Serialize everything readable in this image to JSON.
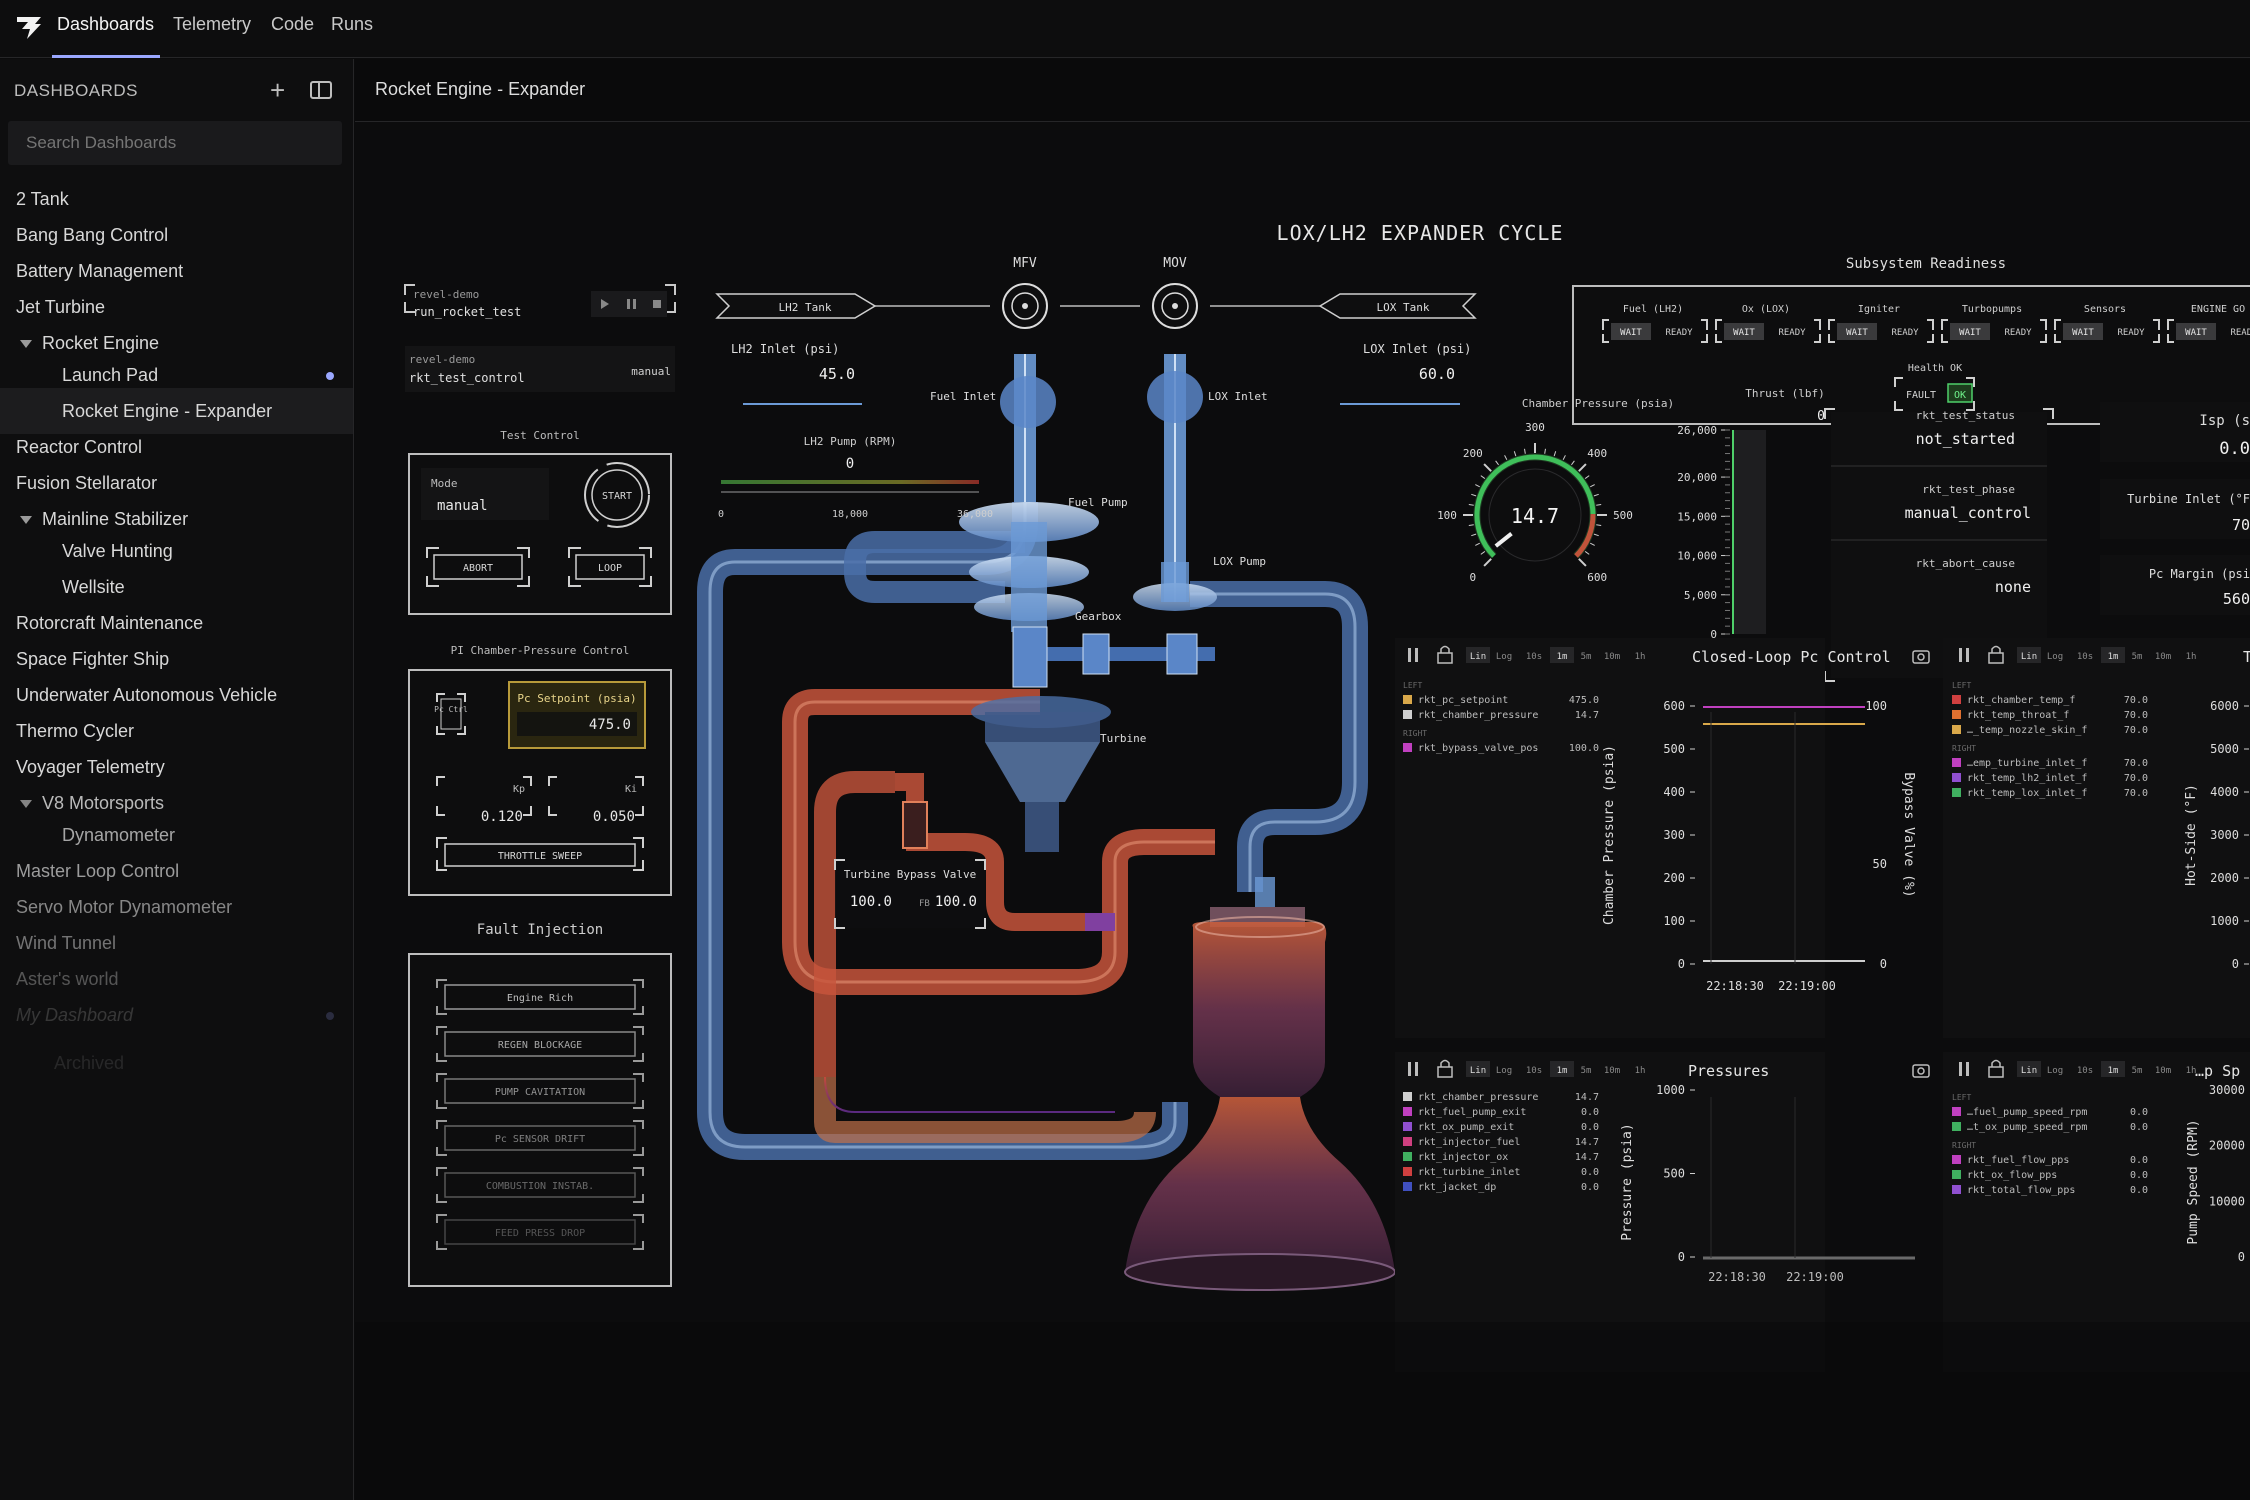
{
  "nav": {
    "tabs": [
      "Dashboards",
      "Telemetry",
      "Code",
      "Runs"
    ]
  },
  "sidebar": {
    "title": "DASHBOARDS",
    "search_placeholder": "Search Dashboards",
    "items": [
      {
        "label": "2 Tank"
      },
      {
        "label": "Bang Bang Control"
      },
      {
        "label": "Battery Management"
      },
      {
        "label": "Jet Turbine"
      },
      {
        "label": "Rocket Engine"
      },
      {
        "label": "Launch Pad"
      },
      {
        "label": "Rocket Engine - Expander"
      },
      {
        "label": "Reactor Control"
      },
      {
        "label": "Fusion Stellarator"
      },
      {
        "label": "Mainline Stabilizer"
      },
      {
        "label": "Valve Hunting"
      },
      {
        "label": "Wellsite"
      },
      {
        "label": "Rotorcraft Maintenance"
      },
      {
        "label": "Space Fighter Ship"
      },
      {
        "label": "Underwater Autonomous Vehicle"
      },
      {
        "label": "Thermo Cycler"
      },
      {
        "label": "Voyager Telemetry"
      },
      {
        "label": "V8 Motorsports"
      },
      {
        "label": "Dynamometer"
      },
      {
        "label": "Master Loop Control"
      },
      {
        "label": "Servo Motor Dynamometer"
      },
      {
        "label": "Wind Tunnel"
      },
      {
        "label": "Aster's world"
      },
      {
        "label": "My Dashboard"
      },
      {
        "label": "Archived"
      }
    ]
  },
  "breadcrumb": "Rocket Engine - Expander",
  "diagram": {
    "title": "LOX/LH2 EXPANDER CYCLE",
    "mfv": "MFV",
    "mov": "MOV",
    "lh2_tank": "LH2 Tank",
    "lox_tank": "LOX Tank",
    "lh2_inlet_label": "LH2 Inlet (psi)",
    "lh2_inlet_value": "45.0",
    "lox_inlet_label": "LOX Inlet (psi)",
    "lox_inlet_value": "60.0",
    "lh2_pump_label": "LH2 Pump (RPM)",
    "lh2_pump_value": "0",
    "lh2_pump_ticks": [
      "0",
      "18,000",
      "36,000"
    ],
    "fuel_inlet": "Fuel Inlet",
    "lox_inlet": "LOX Inlet",
    "fuel_pump": "Fuel Pump",
    "lox_pump": "LOX Pump",
    "gearbox": "Gearbox",
    "turbine": "Turbine",
    "tbv_label": "Turbine Bypass Valve",
    "tbv_cmd": "100.0",
    "tbv_fb_label": "FB",
    "tbv_fb": "100.0"
  },
  "run": {
    "proj1": "revel-demo",
    "name1": "run_rocket_test",
    "proj2": "revel-demo",
    "name2": "rkt_test_control",
    "mode2": "manual"
  },
  "test_control": {
    "title": "Test Control",
    "mode_label": "Mode",
    "mode_value": "manual",
    "start": "START",
    "abort": "ABORT",
    "loop": "LOOP"
  },
  "pi_control": {
    "title": "PI Chamber-Pressure Control",
    "pc_ctrl": "Pc Ctrl",
    "setpoint_label": "Pc Setpoint (psia)",
    "setpoint_value": "475.0",
    "kp_label": "Kp",
    "kp_value": "0.120",
    "ki_label": "Ki",
    "ki_value": "0.050",
    "throttle": "THROTTLE SWEEP"
  },
  "faults": {
    "title": "Fault Injection",
    "items": [
      "Engine Rich",
      "REGEN BLOCKAGE",
      "PUMP CAVITATION",
      "Pc SENSOR DRIFT",
      "COMBUSTION INSTAB.",
      "FEED PRESS DROP"
    ]
  },
  "readiness": {
    "title": "Subsystem Readiness",
    "groups": [
      {
        "name": "Fuel (LH2)",
        "a": "WAIT",
        "b": "READY"
      },
      {
        "name": "Ox (LOX)",
        "a": "WAIT",
        "b": "READY"
      },
      {
        "name": "Igniter",
        "a": "WAIT",
        "b": "READY"
      },
      {
        "name": "Turbopumps",
        "a": "WAIT",
        "b": "READY"
      },
      {
        "name": "Sensors",
        "a": "WAIT",
        "b": "READY"
      },
      {
        "name": "ENGINE GO",
        "a": "WAIT",
        "b": "READY"
      }
    ],
    "health_label": "Health OK",
    "fault": "FAULT",
    "ok": "OK"
  },
  "gauge": {
    "title": "Chamber Pressure (psia)",
    "value": "14.7",
    "reading": 14.7,
    "min": 0,
    "max": 600,
    "ticks": [
      "0",
      "100",
      "200",
      "300",
      "400",
      "500",
      "600"
    ]
  },
  "thrust": {
    "title": "Thrust (lbf)",
    "value": "0",
    "reading": 0,
    "max": 26000,
    "ticks": [
      "26,000",
      "20,000",
      "15,000",
      "10,000",
      "5,000",
      "0"
    ]
  },
  "status": {
    "k1": "rkt_test_status",
    "v1": "not_started",
    "k2": "rkt_test_phase",
    "v2": "manual_control",
    "k3": "rkt_abort_cause",
    "v3": "none"
  },
  "right_metrics": {
    "isp_label": "Isp (s",
    "isp_value": "0.0",
    "tin_label": "Turbine Inlet (°F",
    "tin_value": "70",
    "pcm_label": "Pc Margin (psi",
    "pcm_value": "560"
  },
  "plot_controls": [
    "Lin",
    "Log",
    "10s",
    "1m",
    "5m",
    "10m",
    "1h"
  ],
  "plots": {
    "p1": {
      "title": "Closed-Loop Pc Control",
      "left_header": "LEFT",
      "right_header": "RIGHT",
      "left_series": [
        {
          "name": "rkt_pc_setpoint",
          "value": "475.0",
          "color": "#d9a84a"
        },
        {
          "name": "rkt_chamber_pressure",
          "value": "14.7",
          "color": "#cfcfcf"
        }
      ],
      "right_series": [
        {
          "name": "rkt_bypass_valve_pos",
          "value": "100.0",
          "color": "#c040c0"
        }
      ],
      "ylabel": "Chamber Pressure (psia)",
      "y2label": "Bypass Valve (%)",
      "yticks": [
        "600",
        "500",
        "400",
        "300",
        "200",
        "100",
        "0"
      ],
      "y2ticks": [
        "100",
        "50",
        "0"
      ],
      "xticks": [
        "22:18:30",
        "22:19:00"
      ]
    },
    "p2": {
      "title": "Te",
      "left_header": "LEFT",
      "right_header": "RIGHT",
      "left_series": [
        {
          "name": "rkt_chamber_temp_f",
          "value": "70.0",
          "color": "#d04040"
        },
        {
          "name": "rkt_temp_throat_f",
          "value": "70.0",
          "color": "#e07030"
        },
        {
          "name": "…_temp_nozzle_skin_f",
          "value": "70.0",
          "color": "#d9a84a"
        }
      ],
      "right_series": [
        {
          "name": "…emp_turbine_inlet_f",
          "value": "70.0",
          "color": "#c040c0"
        },
        {
          "name": "rkt_temp_lh2_inlet_f",
          "value": "70.0",
          "color": "#9050d0"
        },
        {
          "name": "rkt_temp_lox_inlet_f",
          "value": "70.0",
          "color": "#40b060"
        }
      ],
      "ylabel": "Hot-Side (°F)",
      "yticks": [
        "6000",
        "5000",
        "4000",
        "3000",
        "2000",
        "1000",
        "0"
      ]
    },
    "p3": {
      "title": "Pressures",
      "left_series": [
        {
          "name": "rkt_chamber_pressure",
          "value": "14.7",
          "color": "#cfcfcf"
        },
        {
          "name": "rkt_fuel_pump_exit",
          "value": "0.0",
          "color": "#c040c0"
        },
        {
          "name": "rkt_ox_pump_exit",
          "value": "0.0",
          "color": "#9050d0"
        },
        {
          "name": "rkt_injector_fuel",
          "value": "14.7",
          "color": "#d04080"
        },
        {
          "name": "rkt_injector_ox",
          "value": "14.7",
          "color": "#40b060"
        },
        {
          "name": "rkt_turbine_inlet",
          "value": "0.0",
          "color": "#d04040"
        },
        {
          "name": "rkt_jacket_dp",
          "value": "0.0",
          "color": "#4050c0"
        }
      ],
      "ylabel": "Pressure (psia)",
      "yticks": [
        "1000",
        "500",
        "0"
      ],
      "xticks": [
        "22:18:30",
        "22:19:00"
      ]
    },
    "p4": {
      "title": "…p Sp",
      "left_header": "LEFT",
      "right_header": "RIGHT",
      "left_series": [
        {
          "name": "…fuel_pump_speed_rpm",
          "value": "0.0",
          "color": "#c040c0"
        },
        {
          "name": "…t_ox_pump_speed_rpm",
          "value": "0.0",
          "color": "#40b060"
        }
      ],
      "right_series": [
        {
          "name": "rkt_fuel_flow_pps",
          "value": "0.0",
          "color": "#c040c0"
        },
        {
          "name": "rkt_ox_flow_pps",
          "value": "0.0",
          "color": "#40b060"
        },
        {
          "name": "rkt_total_flow_pps",
          "value": "0.0",
          "color": "#9050d0"
        }
      ],
      "ylabel": "Pump Speed (RPM)",
      "yticks": [
        "30000",
        "20000",
        "10000",
        "0"
      ]
    }
  },
  "colors": {
    "accent": "#9aa7ff",
    "lh2": "#6c9ad6",
    "hot": "#e0703a",
    "ok": "#4fd06a",
    "gauge": "#3fbf5a",
    "warn": "#c0533a"
  }
}
